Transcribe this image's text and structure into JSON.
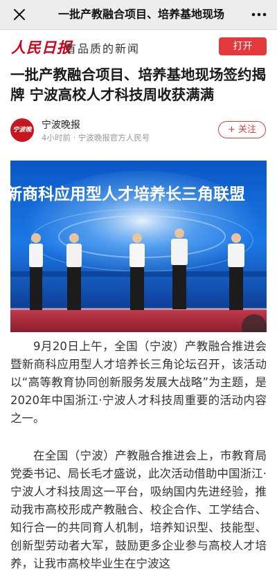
{
  "navbar": {
    "title": "一批产教融合项目、培养基地现场",
    "close_icon": "close-icon",
    "more_icon": "more-dots-icon"
  },
  "brand": {
    "logo_text": "人民日报",
    "slogan": "有品质的新闻",
    "open_label": "打开",
    "accent": "#e4393c"
  },
  "article": {
    "title": "一批产教融合项目、培养基地现场签约揭牌 宁波高校人才科技周收获满满",
    "author": {
      "name": "宁波晚报",
      "avatar_text": "宁波晚报",
      "meta": "4小时前 · 宁波晚报官方人民号",
      "follow_label": "+ 关注"
    },
    "photo": {
      "banner_text": "新商科应用型人才培养长三角联盟"
    },
    "paragraphs": [
      "9月20日上午，全国（宁波）产教融合推进会暨新商科应用型人才培养长三角论坛召开，该活动以“高等教育协同创新服务发展大战略”为主题，是2020年中国浙江·宁波人才科技周重要的活动内容之一。",
      "在全国（宁波）产教融合推进会上，市教育局党委书记、局长毛才盛说，此次活动借助中国浙江·宁波人才科技周这一平台，吸纳国内先进经验，推动我市高校形成产教融合、校企合作、工学结合、知行合一的共同育人机制，培养知识型、技能型、创新型劳动者大军，鼓励更多企业参与高校人才培养，让我市高校毕业生在宁波这"
    ]
  }
}
